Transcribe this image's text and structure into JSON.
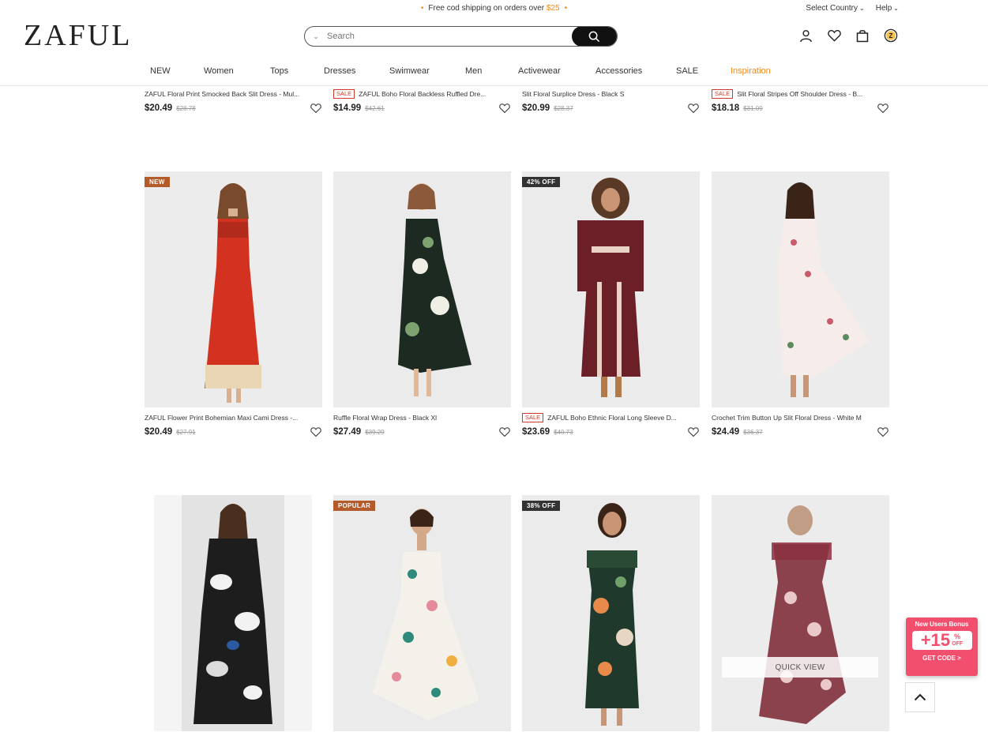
{
  "header": {
    "promo_text": "Free cod shipping on orders over",
    "promo_amount": "$25",
    "select_country": "Select Country",
    "help": "Help",
    "logo": "ZAFUL",
    "search_placeholder": "Search"
  },
  "nav": [
    "NEW",
    "Women",
    "Tops",
    "Dresses",
    "Swimwear",
    "Men",
    "Activewear",
    "Accessories",
    "SALE",
    "Inspiration"
  ],
  "colors": {
    "accent": "#f08a1c",
    "sale_red": "#d0392b",
    "badge_orange": "#b35b2a",
    "badge_dark": "#333333",
    "bonus_pink": "#f24f6e"
  },
  "row1": [
    {
      "title": "ZAFUL Floral Print Smocked Back Slit Dress - Mul...",
      "price": "$20.49",
      "old": "$28.78",
      "sale": ""
    },
    {
      "title": "ZAFUL Boho Floral Backless Ruffled Dre...",
      "price": "$14.99",
      "old": "$42.61",
      "sale": "SALE"
    },
    {
      "title": "Slit Floral Surplice Dress - Black S",
      "price": "$20.99",
      "old": "$28.37",
      "sale": ""
    },
    {
      "title": "Slit Floral Stripes Off Shoulder Dress - B...",
      "price": "$18.18",
      "old": "$31.09",
      "sale": "SALE"
    }
  ],
  "row2": [
    {
      "badge": "NEW",
      "title": "ZAFUL Flower Print Bohemian Maxi Cami Dress -...",
      "price": "$20.49",
      "old": "$27.91",
      "sale": ""
    },
    {
      "badge": "",
      "title": "Ruffle Floral Wrap Dress - Black Xl",
      "price": "$27.49",
      "old": "$39.29",
      "sale": ""
    },
    {
      "badge": "42% OFF",
      "title": "ZAFUL Boho Ethnic Floral Long Sleeve D...",
      "price": "$23.69",
      "old": "$40.73",
      "sale": "SALE"
    },
    {
      "badge": "",
      "title": "Crochet Trim Button Up Slit Floral Dress - White M",
      "price": "$24.49",
      "old": "$36.37",
      "sale": ""
    }
  ],
  "row3": [
    {
      "badge": ""
    },
    {
      "badge": "POPULAR"
    },
    {
      "badge": "38% OFF"
    },
    {
      "badge": "",
      "quick_view": "QUICK VIEW"
    }
  ],
  "bonus": {
    "title": "New Users Bonus",
    "value": "+15",
    "pct": "%",
    "off": "OFF",
    "cta": "GET CODE >"
  }
}
